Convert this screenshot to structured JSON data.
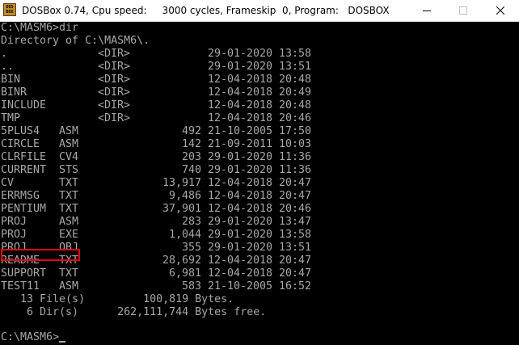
{
  "window": {
    "title": "DOSBox 0.74, Cpu speed:     3000 cycles, Frameskip  0, Program:   DOSBOX",
    "icon_label": "DOS BOX",
    "controls": {
      "minimize_icon": "minimize-icon",
      "maximize_icon": "maximize-icon",
      "close_icon": "close-icon"
    }
  },
  "colors": {
    "terminal_bg": "#000000",
    "terminal_fg": "#a8a8a8",
    "highlight": "#e60012"
  },
  "terminal": {
    "command_line": "C:\\MASM6>dir",
    "directory_header": "Directory of C:\\MASM6\\.",
    "entries": [
      {
        "name": ".",
        "ext": "",
        "dir": "<DIR>",
        "size": "",
        "date": "29-01-2020",
        "time": "13:58"
      },
      {
        "name": "..",
        "ext": "",
        "dir": "<DIR>",
        "size": "",
        "date": "29-01-2020",
        "time": "13:51"
      },
      {
        "name": "BIN",
        "ext": "",
        "dir": "<DIR>",
        "size": "",
        "date": "12-04-2018",
        "time": "20:48"
      },
      {
        "name": "BINR",
        "ext": "",
        "dir": "<DIR>",
        "size": "",
        "date": "12-04-2018",
        "time": "20:49"
      },
      {
        "name": "INCLUDE",
        "ext": "",
        "dir": "<DIR>",
        "size": "",
        "date": "12-04-2018",
        "time": "20:48"
      },
      {
        "name": "TMP",
        "ext": "",
        "dir": "<DIR>",
        "size": "",
        "date": "12-04-2018",
        "time": "20:46"
      },
      {
        "name": "5PLUS4",
        "ext": "ASM",
        "dir": "",
        "size": "492",
        "date": "21-10-2005",
        "time": "17:50"
      },
      {
        "name": "CIRCLE",
        "ext": "ASM",
        "dir": "",
        "size": "142",
        "date": "21-09-2011",
        "time": "10:03"
      },
      {
        "name": "CLRFILE",
        "ext": "CV4",
        "dir": "",
        "size": "203",
        "date": "29-01-2020",
        "time": "11:36"
      },
      {
        "name": "CURRENT",
        "ext": "STS",
        "dir": "",
        "size": "740",
        "date": "29-01-2020",
        "time": "11:36"
      },
      {
        "name": "CV",
        "ext": "TXT",
        "dir": "",
        "size": "13,917",
        "date": "12-04-2018",
        "time": "20:47"
      },
      {
        "name": "ERRMSG",
        "ext": "TXT",
        "dir": "",
        "size": "9,486",
        "date": "12-04-2018",
        "time": "20:47"
      },
      {
        "name": "PENTIUM",
        "ext": "TXT",
        "dir": "",
        "size": "37,901",
        "date": "12-04-2018",
        "time": "20:46"
      },
      {
        "name": "PROJ",
        "ext": "ASM",
        "dir": "",
        "size": "283",
        "date": "29-01-2020",
        "time": "13:47"
      },
      {
        "name": "PROJ",
        "ext": "EXE",
        "dir": "",
        "size": "1,044",
        "date": "29-01-2020",
        "time": "13:58"
      },
      {
        "name": "PROJ",
        "ext": "OBJ",
        "dir": "",
        "size": "355",
        "date": "29-01-2020",
        "time": "13:51"
      },
      {
        "name": "README",
        "ext": "TXT",
        "dir": "",
        "size": "28,692",
        "date": "12-04-2018",
        "time": "20:47"
      },
      {
        "name": "SUPPORT",
        "ext": "TXT",
        "dir": "",
        "size": "6,981",
        "date": "12-04-2018",
        "time": "20:47"
      },
      {
        "name": "TEST11",
        "ext": "ASM",
        "dir": "",
        "size": "583",
        "date": "21-10-2005",
        "time": "16:52"
      }
    ],
    "summary_files": "   13 File(s)         100,819 Bytes.",
    "summary_dirs": "    6 Dir(s)      262,111,744 Bytes free.",
    "prompt": "C:\\MASM6>"
  }
}
